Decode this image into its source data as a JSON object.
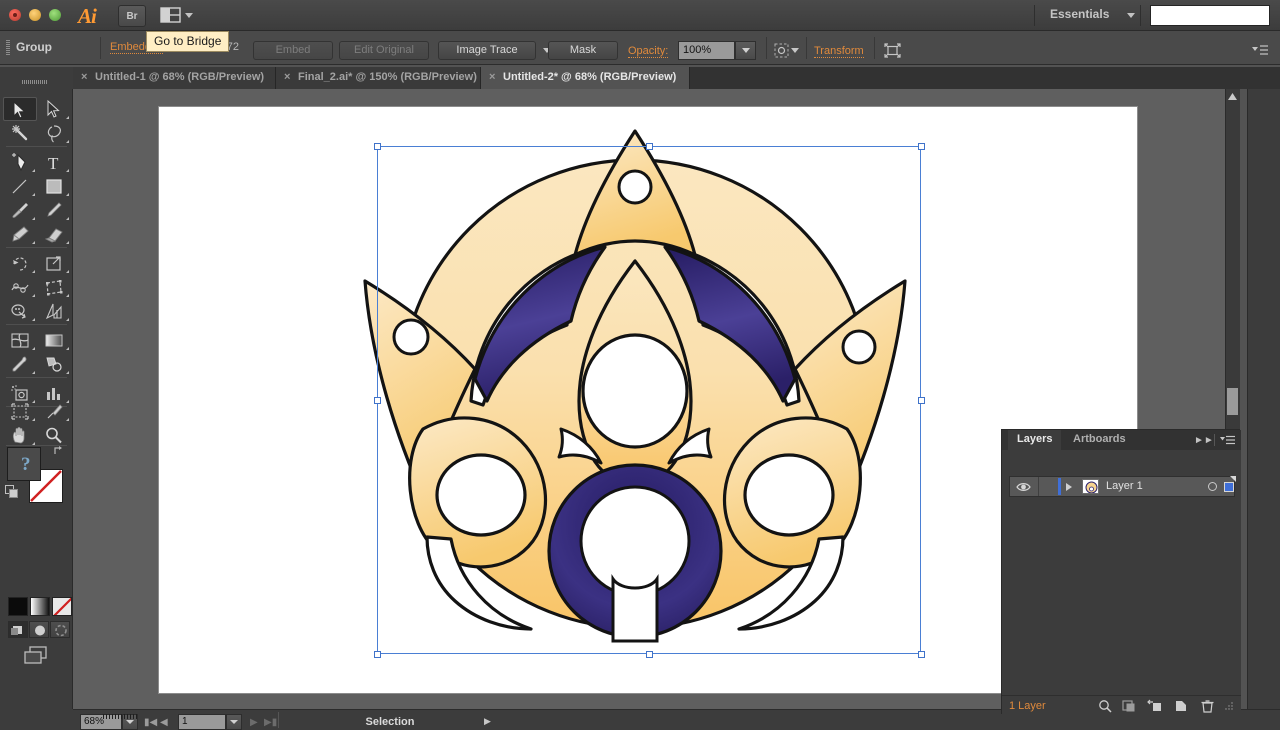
{
  "app": {
    "name": "Adobe Illustrator",
    "logo_text": "Ai",
    "bridge_button_label": "Br",
    "workspace_label": "Essentials",
    "search_value": ""
  },
  "tooltip": {
    "text": "Go to Bridge"
  },
  "control_bar": {
    "selection_type_label": "Group",
    "embedded_label": "Embedded",
    "color_info": "RGB  PPI: 72",
    "embed_button": "Embed",
    "edit_original_button": "Edit Original",
    "image_trace_button": "Image Trace",
    "mask_button": "Mask",
    "opacity_label": "Opacity:",
    "opacity_value": "100%",
    "transform_label": "Transform"
  },
  "document_tabs": [
    {
      "close": "×",
      "label": "Untitled-1 @ 68% (RGB/Preview)",
      "active": false
    },
    {
      "close": "×",
      "label": "Final_2.ai* @ 150% (RGB/Preview)",
      "active": false
    },
    {
      "close": "×",
      "label": "Untitled-2* @ 68% (RGB/Preview)",
      "active": true
    }
  ],
  "tools": [
    {
      "name": "selection-tool",
      "selected": true
    },
    {
      "name": "direct-selection-tool",
      "selected": false
    },
    {
      "name": "magic-wand-tool",
      "selected": false
    },
    {
      "name": "lasso-tool",
      "selected": false
    },
    {
      "name": "pen-tool",
      "selected": false
    },
    {
      "name": "type-tool",
      "selected": false
    },
    {
      "name": "line-segment-tool",
      "selected": false
    },
    {
      "name": "rectangle-tool",
      "selected": false
    },
    {
      "name": "paintbrush-tool",
      "selected": false
    },
    {
      "name": "pencil-tool",
      "selected": false
    },
    {
      "name": "blob-brush-tool",
      "selected": false
    },
    {
      "name": "eraser-tool",
      "selected": false
    },
    {
      "name": "rotate-tool",
      "selected": false
    },
    {
      "name": "scale-tool",
      "selected": false
    },
    {
      "name": "width-tool",
      "selected": false
    },
    {
      "name": "free-transform-tool",
      "selected": false
    },
    {
      "name": "shape-builder-tool",
      "selected": false
    },
    {
      "name": "perspective-grid-tool",
      "selected": false
    },
    {
      "name": "mesh-tool",
      "selected": false
    },
    {
      "name": "gradient-tool",
      "selected": false
    },
    {
      "name": "eyedropper-tool",
      "selected": false
    },
    {
      "name": "blend-tool",
      "selected": false
    },
    {
      "name": "symbol-sprayer-tool",
      "selected": false
    },
    {
      "name": "column-graph-tool",
      "selected": false
    },
    {
      "name": "artboard-tool",
      "selected": false
    },
    {
      "name": "slice-tool",
      "selected": false
    },
    {
      "name": "hand-tool",
      "selected": false
    },
    {
      "name": "zoom-tool",
      "selected": false
    }
  ],
  "fill_stroke": {
    "fill_label": "?",
    "fill_state": "unknown",
    "stroke_state": "none"
  },
  "canvas": {
    "artwork_title": "ornamental-emblem",
    "colors": {
      "gold_light": "#fae3b4",
      "gold_mid": "#f7d694",
      "gold_deep": "#f8c76a",
      "purple_dark": "#2e2470",
      "purple_mid": "#4a3f93",
      "outline": "#141414",
      "selection": "#4a7fd4",
      "artboard": "#ffffff"
    }
  },
  "status_bar": {
    "zoom_value": "68%",
    "artboard_value": "1",
    "status_text": "Selection"
  },
  "layers_panel": {
    "tabs": [
      {
        "label": "Layers",
        "active": true
      },
      {
        "label": "Artboards",
        "active": false
      }
    ],
    "rows": [
      {
        "name": "Layer 1",
        "visible": true,
        "locked": false,
        "selected": true
      }
    ],
    "footer_count": "1 Layer",
    "footer_icons": [
      "search-icon",
      "make-clipping-mask-icon",
      "create-sublayer-icon",
      "create-new-layer-icon",
      "delete-layer-icon"
    ]
  },
  "right_dock": {
    "icons": [
      "color-icon",
      "color-guide-icon",
      "swatches-icon",
      "brushes-icon",
      "symbols-icon",
      "stroke-icon",
      "gradient-icon",
      "transform-icon",
      "align-icon",
      "pathfinder-icon",
      "transparency-icon",
      "appearance-icon",
      "layers-icon",
      "artboards-icon"
    ],
    "active_icon": "layers-icon"
  }
}
